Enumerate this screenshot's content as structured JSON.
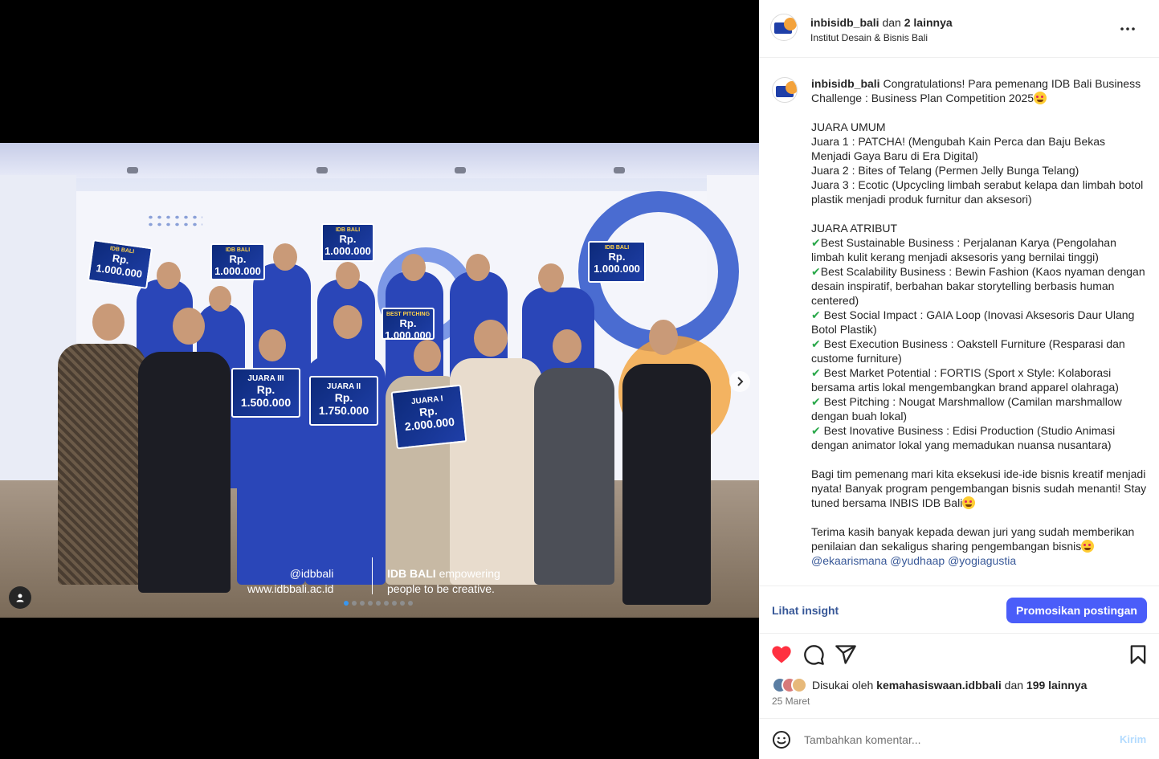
{
  "post": {
    "author": "inbisidb_bali",
    "and_text": "dan",
    "others": "2 lainnya",
    "subtitle": "Institut Desain & Bisnis Bali",
    "more_icon": "more-horizontal-icon"
  },
  "photo": {
    "watermark_handle": "@idbbali",
    "watermark_url": "www.idbbali.ac.id",
    "watermark_brand": "IDB BALI",
    "watermark_tagline_1": "empowering",
    "watermark_tagline_2": "people to be creative.",
    "boards": [
      {
        "title": "IDB BALI",
        "amount": "Rp. 1.000.000"
      },
      {
        "title": "IDB BALI",
        "amount": "Rp. 1.000.000"
      },
      {
        "title": "IDB BALI",
        "amount": "Rp. 1.000.000"
      },
      {
        "title": "IDB BALI",
        "amount": "Rp. 1.000.000"
      },
      {
        "title": "JUARA III",
        "amount": "Rp. 1.500.000"
      },
      {
        "title": "JUARA II",
        "amount": "Rp. 1.750.000"
      },
      {
        "title": "JUARA I",
        "amount": "Rp. 2.000.000"
      },
      {
        "title": "BEST PITCHING",
        "amount": "Rp. 1.000.000"
      }
    ],
    "carousel_count": 9,
    "carousel_active": 0
  },
  "caption": {
    "username": "inbisidb_bali",
    "intro": "Congratulations! Para pemenang IDB Bali Business Challenge : Business Plan Competition 2025",
    "juara_umum_title": "JUARA UMUM",
    "juara_umum": [
      "Juara 1 : PATCHA! (Mengubah Kain Perca dan Baju Bekas Menjadi Gaya Baru di Era Digital)",
      "Juara 2 : Bites of Telang (Permen Jelly Bunga Telang)",
      "Juara 3 : Ecotic (Upcycling limbah serabut kelapa dan limbah botol plastik menjadi produk furnitur dan aksesori)"
    ],
    "juara_atribut_title": "JUARA ATRIBUT",
    "check_mark": "✔",
    "juara_atribut": [
      "Best Sustainable Business : Perjalanan Karya (Pengolahan limbah kulit kerang menjadi aksesoris yang bernilai tinggi)",
      "Best Scalability Business : Bewin Fashion (Kaos nyaman dengan desain inspiratif, berbahan bakar storytelling berbasis human centered)",
      " Best Social Impact : GAIA Loop (Inovasi Aksesoris Daur Ulang Botol Plastik)",
      " Best Execution Business : Oakstell Furniture (Resparasi dan custome furniture)",
      " Best Market Potential : FORTIS (Sport x Style: Kolaborasi bersama artis lokal mengembangkan brand apparel olahraga)",
      " Best Pitching : Nougat Marshmallow (Camilan marshmallow dengan buah lokal)",
      " Best Inovative Business : Edisi Production (Studio Animasi dengan animator lokal yang memadukan nuansa nusantara)"
    ],
    "closing": "Bagi tim pemenang mari kita eksekusi ide-ide bisnis kreatif menjadi nyata! Banyak program pengembangan bisnis sudah menanti! Stay tuned bersama INBIS IDB Bali",
    "thanks": "Terima kasih banyak kepada dewan juri yang sudah memberikan penilaian dan sekaligus sharing pengembangan bisnis",
    "mentions": "@ekaarismana @yudhaap @yogiagustia"
  },
  "insight": {
    "link": "Lihat insight",
    "promote": "Promosikan postingan"
  },
  "actions": {
    "like_color": "#ff3040"
  },
  "likes": {
    "prefix": "Disukai oleh",
    "user": "kemahasiswaan.idbbali",
    "mid": "dan",
    "count": "199 lainnya"
  },
  "date": "25 Maret",
  "comment": {
    "placeholder": "Tambahkan komentar...",
    "send": "Kirim"
  }
}
